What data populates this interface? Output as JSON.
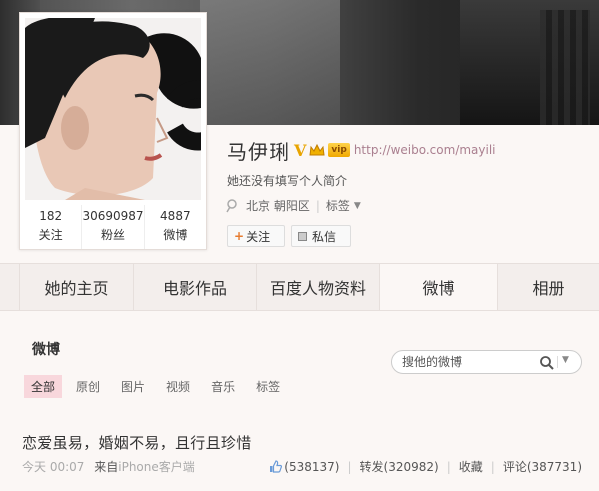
{
  "profile": {
    "name": "马伊琍",
    "verified_mark": "V",
    "vip_label": "vip",
    "url": "http://weibo.com/mayili",
    "bio": "她还没有填写个人简介",
    "location": "北京 朝阳区",
    "tags_label": "标签",
    "stats": [
      {
        "value": "182",
        "label": "关注"
      },
      {
        "value": "30690987",
        "label": "粉丝"
      },
      {
        "value": "4887",
        "label": "微博"
      }
    ],
    "follow_button": "关注",
    "message_button": "私信"
  },
  "tabs": [
    "",
    "她的主页",
    "电影作品",
    "百度人物资料",
    "微博",
    "相册"
  ],
  "active_tab_index": 4,
  "feed": {
    "section_title": "微博",
    "search_placeholder": "搜他的微博",
    "filters": [
      "全部",
      "原创",
      "图片",
      "视频",
      "音乐",
      "标签"
    ],
    "active_filter_index": 0
  },
  "post": {
    "text": "恋爱虽易，婚姻不易，且行且珍惜",
    "time": "今天 00:07",
    "source_prefix": "来自",
    "source_app": "iPhone客户端",
    "likes": "(538137)",
    "repost_label": "转发",
    "repost_count": "(320982)",
    "favorite_label": "收藏",
    "comment_label": "评论",
    "comment_count": "(387731)"
  },
  "colors": {
    "page_bg": "#fbf7f5",
    "active_filter_bg": "#f8d7dc",
    "verified_gold": "#e8a400",
    "follow_plus": "#e77c30"
  }
}
